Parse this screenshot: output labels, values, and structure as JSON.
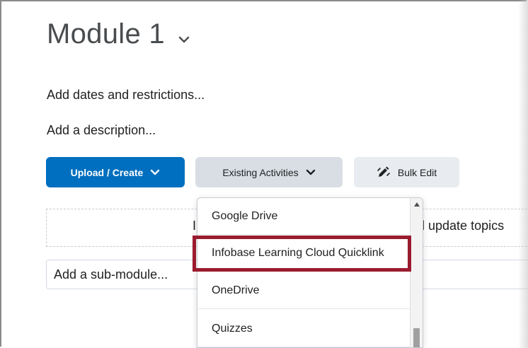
{
  "module": {
    "title": "Module 1",
    "add_dates_link": "Add dates and restrictions...",
    "add_description_link": "Add a description..."
  },
  "toolbar": {
    "upload_create_label": "Upload / Create",
    "existing_activities_label": "Existing Activities",
    "bulk_edit_label": "Bulk Edit",
    "primary_color": "#006fbf",
    "highlight_color": "#9b1b2e"
  },
  "dropzone": {
    "partial_left": "I",
    "partial_right": "d update topics"
  },
  "submodule": {
    "placeholder": "Add a sub-module..."
  },
  "existing_activities_menu": {
    "items": [
      "Google Drive",
      "Infobase Learning Cloud Quicklink",
      "OneDrive",
      "Quizzes"
    ],
    "highlighted_item": "Infobase Learning Cloud Quicklink"
  }
}
